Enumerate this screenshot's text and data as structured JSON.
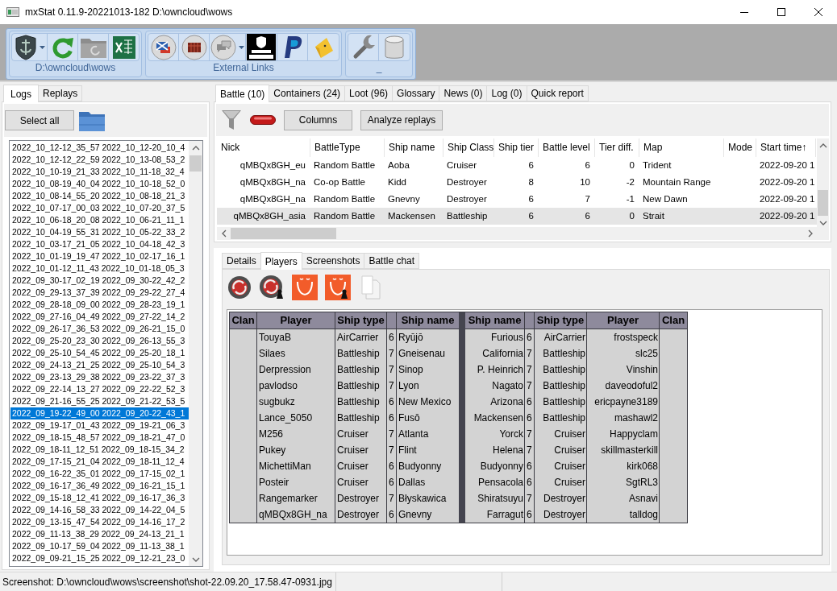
{
  "window": {
    "title": "mxStat 0.11.9-20221013-182 D:\\owncloud\\wows"
  },
  "ribbon": {
    "groups": [
      {
        "label": "D:\\owncloud\\wows"
      },
      {
        "label": "External Links"
      },
      {
        "label": "_"
      }
    ]
  },
  "left_panel": {
    "tabs": [
      {
        "label": "Logs",
        "selected": true
      },
      {
        "label": "Replays",
        "selected": false
      }
    ],
    "select_all": "Select all",
    "logs": [
      {
        "text": "2022_10_12-12_35_57 2022_10_12-20_10_4",
        "selected": false
      },
      {
        "text": "2022_10_12-12_22_59 2022_10_13-08_53_2",
        "selected": false
      },
      {
        "text": "2022_10_10-19_21_33 2022_10_11-18_32_4",
        "selected": false
      },
      {
        "text": "2022_10_08-19_40_04 2022_10_10-18_52_0",
        "selected": false
      },
      {
        "text": "2022_10_08-14_55_20 2022_10_08-18_21_3",
        "selected": false
      },
      {
        "text": "2022_10_07-17_00_03 2022_10_07-20_37_5",
        "selected": false
      },
      {
        "text": "2022_10_06-18_20_08 2022_10_06-21_11_1",
        "selected": false
      },
      {
        "text": "2022_10_04-19_55_31 2022_10_05-22_33_2",
        "selected": false
      },
      {
        "text": "2022_10_03-17_21_05 2022_10_04-18_42_3",
        "selected": false
      },
      {
        "text": "2022_10_01-19_19_47 2022_10_02-17_16_1",
        "selected": false
      },
      {
        "text": "2022_10_01-12_11_43 2022_10_01-18_05_3",
        "selected": false
      },
      {
        "text": "2022_09_30-17_02_19 2022_09_30-22_42_2",
        "selected": false
      },
      {
        "text": "2022_09_29-13_37_39 2022_09_29-22_27_4",
        "selected": false
      },
      {
        "text": "2022_09_28-18_09_00 2022_09_28-23_19_1",
        "selected": false
      },
      {
        "text": "2022_09_27-16_04_49 2022_09_27-22_14_2",
        "selected": false
      },
      {
        "text": "2022_09_26-17_36_53 2022_09_26-21_15_0",
        "selected": false
      },
      {
        "text": "2022_09_25-20_23_30 2022_09_26-13_55_3",
        "selected": false
      },
      {
        "text": "2022_09_25-10_54_45 2022_09_25-20_18_1",
        "selected": false
      },
      {
        "text": "2022_09_24-13_21_25 2022_09_25-10_54_3",
        "selected": false
      },
      {
        "text": "2022_09_23-13_29_38 2022_09_23-22_37_3",
        "selected": false
      },
      {
        "text": "2022_09_22-14_13_27 2022_09_22-22_52_3",
        "selected": false
      },
      {
        "text": "2022_09_21-16_55_25 2022_09_21-22_53_5",
        "selected": false
      },
      {
        "text": "2022_09_19-22_49_00 2022_09_20-22_43_1",
        "selected": true
      },
      {
        "text": "2022_09_19-17_01_43 2022_09_19-21_06_3",
        "selected": false
      },
      {
        "text": "2022_09_18-15_48_57 2022_09_18-21_47_0",
        "selected": false
      },
      {
        "text": "2022_09_18-11_12_51 2022_09_18-15_34_2",
        "selected": false
      },
      {
        "text": "2022_09_17-15_21_04 2022_09_18-11_12_4",
        "selected": false
      },
      {
        "text": "2022_09_16-22_35_01 2022_09_17-15_02_1",
        "selected": false
      },
      {
        "text": "2022_09_16-17_36_49 2022_09_16-21_15_1",
        "selected": false
      },
      {
        "text": "2022_09_15-18_12_41 2022_09_16-17_36_3",
        "selected": false
      },
      {
        "text": "2022_09_14-16_58_33 2022_09_14-22_04_5",
        "selected": false
      },
      {
        "text": "2022_09_13-15_47_54 2022_09_14-16_17_2",
        "selected": false
      },
      {
        "text": "2022_09_11-13_38_29 2022_09_24-13_21_1",
        "selected": false
      },
      {
        "text": "2022_09_10-17_59_04 2022_09_11-13_38_1",
        "selected": false
      },
      {
        "text": "2022_09_09-21_15_25 2022_09_12-21_23_0",
        "selected": false
      }
    ]
  },
  "battle_tabs": [
    {
      "label": "Battle (10)",
      "selected": true
    },
    {
      "label": "Containers (24)",
      "selected": false
    },
    {
      "label": "Loot (96)",
      "selected": false
    },
    {
      "label": "Glossary",
      "selected": false
    },
    {
      "label": "News (0)",
      "selected": false
    },
    {
      "label": "Log (0)",
      "selected": false
    },
    {
      "label": "Quick report",
      "selected": false
    }
  ],
  "battle_toolbar": {
    "buttons": [
      "Columns",
      "Analyze replays"
    ]
  },
  "battle_table": {
    "columns": [
      "Nick",
      "BattleType",
      "Ship name",
      "Ship Class",
      "Ship tier",
      "Battle level",
      "Tier diff.",
      "Map",
      "Mode",
      "Start time↑"
    ],
    "rows": [
      {
        "nick": "qMBQx8GH_eu",
        "battle_type": "Random Battle",
        "ship_name": "Aoba",
        "ship_class": "Cruiser",
        "ship_tier": "6",
        "battle_level": "6",
        "tier_diff": "0",
        "map": "Trident",
        "start_time": "2022-09-20 1",
        "selected": false
      },
      {
        "nick": "qMBQx8GH_na",
        "battle_type": "Co-op Battle",
        "ship_name": "Kidd",
        "ship_class": "Destroyer",
        "ship_tier": "8",
        "battle_level": "10",
        "tier_diff": "-2",
        "map": "Mountain Range",
        "start_time": "2022-09-20 1",
        "selected": false
      },
      {
        "nick": "qMBQx8GH_na",
        "battle_type": "Random Battle",
        "ship_name": "Gnevny",
        "ship_class": "Destroyer",
        "ship_tier": "6",
        "battle_level": "7",
        "tier_diff": "-1",
        "map": "New Dawn",
        "start_time": "2022-09-20 1",
        "selected": false
      },
      {
        "nick": "qMBQx8GH_asia",
        "battle_type": "Random Battle",
        "ship_name": "Mackensen",
        "ship_class": "Battleship",
        "ship_tier": "6",
        "battle_level": "6",
        "tier_diff": "0",
        "map": "Strait",
        "start_time": "2022-09-20 1",
        "selected": true
      }
    ]
  },
  "detail_tabs": [
    {
      "label": "Details",
      "selected": false
    },
    {
      "label": "Players",
      "selected": true
    },
    {
      "label": "Screenshots",
      "selected": false
    },
    {
      "label": "Battle chat",
      "selected": false
    }
  ],
  "players_table": {
    "left_headers": {
      "clan": "Clan",
      "player": "Player",
      "ship_type": "Ship type",
      "ship_name": "Ship name"
    },
    "right_headers": {
      "ship_name": "Ship name",
      "ship_type": "Ship type",
      "player": "Player",
      "clan": "Clan"
    },
    "rows": [
      {
        "left": {
          "player": "TouyaB",
          "ship_type": "AirCarrier",
          "tier": "6",
          "ship_name": "Ryūjō"
        },
        "right": {
          "ship_name": "Furious",
          "tier": "6",
          "ship_type": "AirCarrier",
          "player": "frostspeck"
        }
      },
      {
        "left": {
          "player": "Silaes",
          "ship_type": "Battleship",
          "tier": "7",
          "ship_name": "Gneisenau"
        },
        "right": {
          "ship_name": "California",
          "tier": "7",
          "ship_type": "Battleship",
          "player": "slc25"
        }
      },
      {
        "left": {
          "player": "Derpression",
          "ship_type": "Battleship",
          "tier": "7",
          "ship_name": "Sinop"
        },
        "right": {
          "ship_name": "P. Heinrich",
          "tier": "7",
          "ship_type": "Battleship",
          "player": "Vinshin"
        }
      },
      {
        "left": {
          "player": "pavlodso",
          "ship_type": "Battleship",
          "tier": "7",
          "ship_name": "Lyon"
        },
        "right": {
          "ship_name": "Nagato",
          "tier": "7",
          "ship_type": "Battleship",
          "player": "daveodoful2"
        }
      },
      {
        "left": {
          "player": "sugbukz",
          "ship_type": "Battleship",
          "tier": "6",
          "ship_name": "New Mexico"
        },
        "right": {
          "ship_name": "Arizona",
          "tier": "6",
          "ship_type": "Battleship",
          "player": "ericpayne3189"
        }
      },
      {
        "left": {
          "player": "Lance_5050",
          "ship_type": "Battleship",
          "tier": "6",
          "ship_name": "Fusō"
        },
        "right": {
          "ship_name": "Mackensen",
          "tier": "6",
          "ship_type": "Battleship",
          "player": "mashawl2"
        }
      },
      {
        "left": {
          "player": "M256",
          "ship_type": "Cruiser",
          "tier": "7",
          "ship_name": "Atlanta"
        },
        "right": {
          "ship_name": "Yorck",
          "tier": "7",
          "ship_type": "Cruiser",
          "player": "Happyclam"
        }
      },
      {
        "left": {
          "player": "Pukey",
          "ship_type": "Cruiser",
          "tier": "7",
          "ship_name": "Flint"
        },
        "right": {
          "ship_name": "Helena",
          "tier": "7",
          "ship_type": "Cruiser",
          "player": "skillmasterkill"
        }
      },
      {
        "left": {
          "player": "MichettiMan",
          "ship_type": "Cruiser",
          "tier": "6",
          "ship_name": "Budyonny"
        },
        "right": {
          "ship_name": "Budyonny",
          "tier": "6",
          "ship_type": "Cruiser",
          "player": "kirk068"
        }
      },
      {
        "left": {
          "player": "Posteir",
          "ship_type": "Cruiser",
          "tier": "6",
          "ship_name": "Dallas"
        },
        "right": {
          "ship_name": "Pensacola",
          "tier": "6",
          "ship_type": "Cruiser",
          "player": "SgtRL3"
        }
      },
      {
        "left": {
          "player": "Rangemarker",
          "ship_type": "Destroyer",
          "tier": "7",
          "ship_name": "Błyskawica"
        },
        "right": {
          "ship_name": "Shiratsuyu",
          "tier": "7",
          "ship_type": "Destroyer",
          "player": "Asnavi"
        }
      },
      {
        "left": {
          "player": "qMBQx8GH_na",
          "ship_type": "Destroyer",
          "tier": "6",
          "ship_name": "Gnevny"
        },
        "right": {
          "ship_name": "Farragut",
          "tier": "6",
          "ship_type": "Destroyer",
          "player": "talldog"
        }
      }
    ]
  },
  "status_bar": {
    "text": "Screenshot: D:\\owncloud\\wows\\screenshot\\shot-22.09.20_17.58.47-0931.jpg"
  }
}
